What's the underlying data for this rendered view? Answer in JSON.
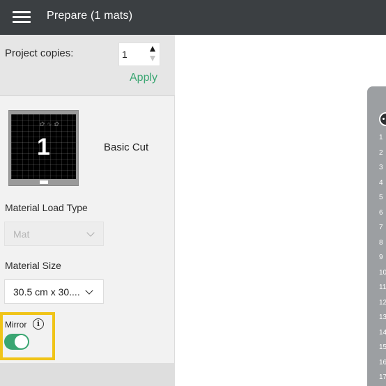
{
  "header": {
    "title": "Prepare (1 mats)"
  },
  "copies": {
    "label": "Project copies:",
    "value": "1",
    "apply_label": "Apply"
  },
  "mat": {
    "number": "1",
    "label": "Basic Cut"
  },
  "load_type": {
    "label": "Material Load Type",
    "value": "Mat"
  },
  "size": {
    "label": "Material Size",
    "value": "30.5 cm x 30...."
  },
  "mirror": {
    "label": "Mirror",
    "info_glyph": "i",
    "enabled": true
  },
  "ruler": {
    "numbers": [
      "1",
      "2",
      "3",
      "4",
      "5",
      "6",
      "7",
      "8",
      "9",
      "10",
      "11",
      "12",
      "13",
      "14",
      "15",
      "16",
      "17"
    ]
  },
  "colors": {
    "accent": "#3aa672",
    "header_bg": "#3b3f42",
    "highlight": "#f0c419"
  }
}
